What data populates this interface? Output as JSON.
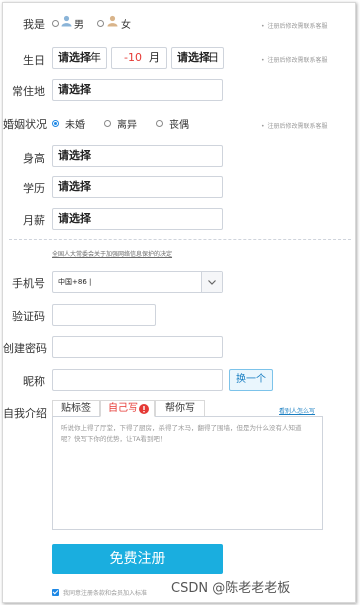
{
  "form": {
    "gender": {
      "label": "我是",
      "male": "男",
      "female": "女"
    },
    "birthday": {
      "label": "生日",
      "year_value": "请选择",
      "year_unit": "年",
      "month_value": "-10",
      "month_unit": "月",
      "day_value": "请选择",
      "day_unit": "日"
    },
    "residence": {
      "label": "常住地",
      "value": "请选择"
    },
    "marital": {
      "label": "婚姻状况",
      "options": [
        "未婚",
        "离异",
        "丧偶"
      ],
      "selected": "未婚"
    },
    "height": {
      "label": "身高",
      "value": "请选择"
    },
    "education": {
      "label": "学历",
      "value": "请选择"
    },
    "salary": {
      "label": "月薪",
      "value": "请选择"
    },
    "note": "注册后修改需联系客服"
  },
  "notice_link": "全国人大常委会关于加强网络信息保护的决定",
  "account": {
    "phone": {
      "label": "手机号",
      "value": "中国+86 |"
    },
    "code": {
      "label": "验证码"
    },
    "password": {
      "label": "创建密码"
    },
    "nickname": {
      "label": "昵称",
      "button": "换一个"
    }
  },
  "intro": {
    "label": "自我介绍",
    "tabs": [
      "贴标签",
      "自己写",
      "帮你写"
    ],
    "active_tab": "自己写",
    "help_link": "看别人怎么写",
    "placeholder": "听说你上得了厅堂，下得了厨房，杀得了木马，翻得了围墙，但是为什么没有人知道呢？快写下你的优势，让TA看到吧！"
  },
  "submit": {
    "label": "免费注册"
  },
  "agreement": {
    "text": "我同意注册条款和会员加入标准"
  },
  "watermark": "CSDN @陈老老老板",
  "colors": {
    "accent": "#1aaedf",
    "radio": "#1e88e5",
    "active_tab": "#e53935",
    "alert": "#e53935"
  }
}
